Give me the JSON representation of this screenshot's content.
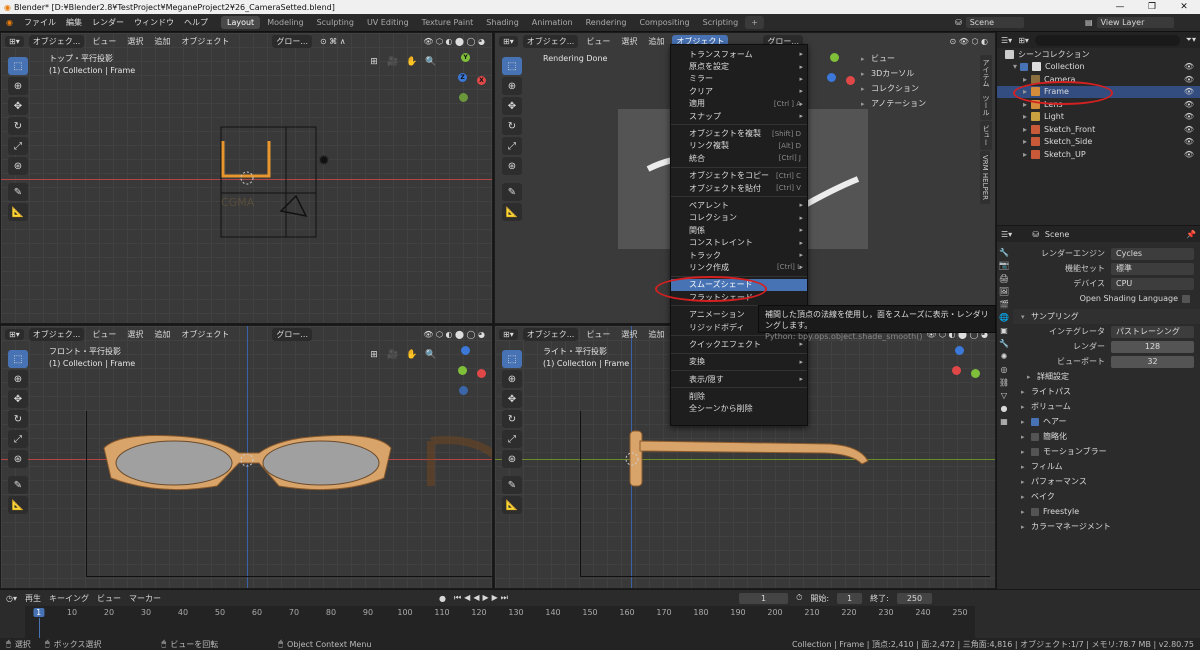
{
  "window": {
    "title": "Blender* [D:¥Blender2.8¥TestProject¥MeganeProject2¥26_CameraSetted.blend]",
    "controls": [
      "—",
      "❐",
      "✕"
    ]
  },
  "topbar": {
    "menus": [
      "ファイル",
      "編集",
      "レンダー",
      "ウィンドウ",
      "ヘルプ"
    ],
    "workspaces": [
      "Layout",
      "Modeling",
      "Sculpting",
      "UV Editing",
      "Texture Paint",
      "Shading",
      "Animation",
      "Rendering",
      "Compositing",
      "Scripting"
    ],
    "active_workspace": "Layout",
    "add_tab": "+",
    "scene": "Scene",
    "view_layer": "View Layer"
  },
  "viewport_header": {
    "mode": "オブジェク...",
    "menus": [
      "ビュー",
      "選択",
      "追加",
      "オブジェクト"
    ],
    "orientation": "グロー...",
    "object_menu_active": "オブジェクト"
  },
  "viewports": {
    "top_left": {
      "line1": "トップ・平行投影",
      "line2": "(1) Collection | Frame"
    },
    "top_right": {
      "line1": "Rendering Done"
    },
    "bottom_left": {
      "line1": "フロント・平行投影",
      "line2": "(1) Collection | Frame"
    },
    "bottom_right": {
      "line1": "ライト・平行投影",
      "line2": "(1) Collection | Frame"
    }
  },
  "gizmo_labels": {
    "z": "Z",
    "x": "X",
    "y": "Y"
  },
  "object_menu": {
    "items": [
      {
        "label": "トランスフォーム",
        "shortcut": "",
        "sub": true
      },
      {
        "label": "原点を設定",
        "shortcut": "",
        "sub": true
      },
      {
        "label": "ミラー",
        "shortcut": "",
        "sub": true
      },
      {
        "label": "クリア",
        "shortcut": "",
        "sub": true
      },
      {
        "label": "適用",
        "shortcut": "[Ctrl ] A",
        "sub": true
      },
      {
        "label": "スナップ",
        "shortcut": "",
        "sub": true
      },
      {
        "sep": true
      },
      {
        "label": "オブジェクトを複製",
        "shortcut": "[Shift] D",
        "sub": false
      },
      {
        "label": "リンク複製",
        "shortcut": "[Alt] D",
        "sub": false
      },
      {
        "label": "統合",
        "shortcut": "[Ctrl] J",
        "sub": false
      },
      {
        "sep": true
      },
      {
        "label": "オブジェクトをコピー",
        "shortcut": "[Ctrl] C",
        "sub": false
      },
      {
        "label": "オブジェクトを貼付",
        "shortcut": "[Ctrl] V",
        "sub": false
      },
      {
        "sep": true
      },
      {
        "label": "ペアレント",
        "shortcut": "",
        "sub": true
      },
      {
        "label": "コレクション",
        "shortcut": "",
        "sub": true
      },
      {
        "label": "関係",
        "shortcut": "",
        "sub": true
      },
      {
        "label": "コンストレイント",
        "shortcut": "",
        "sub": true
      },
      {
        "label": "トラック",
        "shortcut": "",
        "sub": true
      },
      {
        "label": "リンク作成",
        "shortcut": "[Ctrl] L",
        "sub": true
      },
      {
        "sep": true
      },
      {
        "label": "スムーズシェード",
        "shortcut": "",
        "sub": false,
        "highlight": true
      },
      {
        "label": "フラットシェード",
        "shortcut": "",
        "sub": false
      },
      {
        "sep": true
      },
      {
        "label": "アニメーション",
        "shortcut": "",
        "sub": true
      },
      {
        "label": "リジッドボディ",
        "shortcut": "",
        "sub": true
      },
      {
        "sep": true
      },
      {
        "label": "クイックエフェクト",
        "shortcut": "",
        "sub": true
      },
      {
        "sep": true
      },
      {
        "label": "変換",
        "shortcut": "",
        "sub": true
      },
      {
        "sep": true
      },
      {
        "label": "表示/隠す",
        "shortcut": "",
        "sub": true
      },
      {
        "sep": true
      },
      {
        "label": "削除",
        "shortcut": "",
        "sub": false
      },
      {
        "label": "全シーンから削除",
        "shortcut": "",
        "sub": false
      }
    ]
  },
  "tooltip": {
    "text": "補間した頂点の法線を使用し，面をスムーズに表示・レンダリングします。",
    "python": "Python: bpy.ops.object.shade_smooth()"
  },
  "sidebar_panel": {
    "items": [
      "ビュー",
      "3Dカーソル",
      "コレクション",
      "アノテーション"
    ],
    "tabs": [
      "アイテム",
      "ツール",
      "ビュー",
      "VRM HELPER"
    ]
  },
  "outliner": {
    "root": "シーンコレクション",
    "collection": "Collection",
    "items": [
      {
        "name": "Camera",
        "color": "#8b6f3f",
        "selected": false
      },
      {
        "name": "Frame",
        "color": "#d48b3a",
        "selected": true
      },
      {
        "name": "Lens",
        "color": "#d48b3a",
        "selected": false
      },
      {
        "name": "Light",
        "color": "#c8a040",
        "selected": false
      },
      {
        "name": "Sketch_Front",
        "color": "#c85a3a",
        "selected": false
      },
      {
        "name": "Sketch_Side",
        "color": "#c85a3a",
        "selected": false
      },
      {
        "name": "Sketch_UP",
        "color": "#c85a3a",
        "selected": false
      }
    ]
  },
  "properties": {
    "scene_name": "Scene",
    "fields": [
      {
        "label": "レンダーエンジン",
        "value": "Cycles"
      },
      {
        "label": "機能セット",
        "value": "標準"
      },
      {
        "label": "デバイス",
        "value": "CPU"
      }
    ],
    "osl": "Open Shading Language",
    "sampling": {
      "title": "サンプリング",
      "integrator_label": "インテグレータ",
      "integrator": "パストレーシング",
      "render_label": "レンダー",
      "render": "128",
      "viewport_label": "ビューポート",
      "viewport": "32",
      "advanced": "詳細設定"
    },
    "sections": [
      {
        "label": "ライトパス",
        "check": null
      },
      {
        "label": "ボリューム",
        "check": null
      },
      {
        "label": "ヘアー",
        "check": true
      },
      {
        "label": "簡略化",
        "check": false
      },
      {
        "label": "モーションブラー",
        "check": false
      },
      {
        "label": "フィルム",
        "check": null
      },
      {
        "label": "パフォーマンス",
        "check": null
      },
      {
        "label": "ベイク",
        "check": null
      },
      {
        "label": "Freestyle",
        "check": false
      },
      {
        "label": "カラーマネージメント",
        "check": null
      }
    ]
  },
  "timeline": {
    "menus": [
      "再生",
      "キーイング",
      "ビュー",
      "マーカー"
    ],
    "current_frame": "1",
    "start_label": "開始:",
    "start": "1",
    "end_label": "終了:",
    "end": "250",
    "ticks": [
      "1",
      "10",
      "20",
      "30",
      "40",
      "50",
      "60",
      "70",
      "80",
      "90",
      "100",
      "110",
      "120",
      "130",
      "140",
      "150",
      "160",
      "170",
      "180",
      "190",
      "200",
      "210",
      "220",
      "230",
      "240",
      "250"
    ]
  },
  "statusbar": {
    "left": [
      "選択",
      "ボックス選択",
      "ビューを回転",
      "Object Context Menu"
    ],
    "right": "Collection | Frame | 頂点:2,410 | 面:2,472 | 三角面:4,816 | オブジェクト:1/7 | メモリ:78.7 MB | v2.80.75"
  },
  "colors": {
    "accent": "#4772b3",
    "annotation": "#d42020",
    "object_orange": "#e8972e"
  }
}
